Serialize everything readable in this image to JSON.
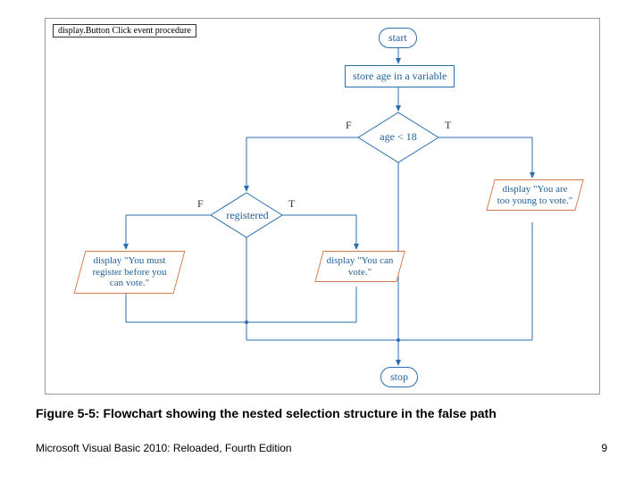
{
  "procedure_label": "display.Button Click event procedure",
  "nodes": {
    "start": "start",
    "store": "store age in a variable",
    "age_cond": "age < 18",
    "reg_cond": "registered",
    "out_too_young": "display \"You are too young to vote.\"",
    "out_must_register": "display \"You must register before you can vote.\"",
    "out_can_vote": "display \"You can vote.\"",
    "stop": "stop"
  },
  "branches": {
    "age_false": "F",
    "age_true": "T",
    "reg_false": "F",
    "reg_true": "T"
  },
  "caption": "Figure 5-5: Flowchart showing the nested selection structure in the false path",
  "footer_left": "Microsoft Visual Basic 2010: Reloaded, Fourth Edition",
  "footer_right": "9"
}
